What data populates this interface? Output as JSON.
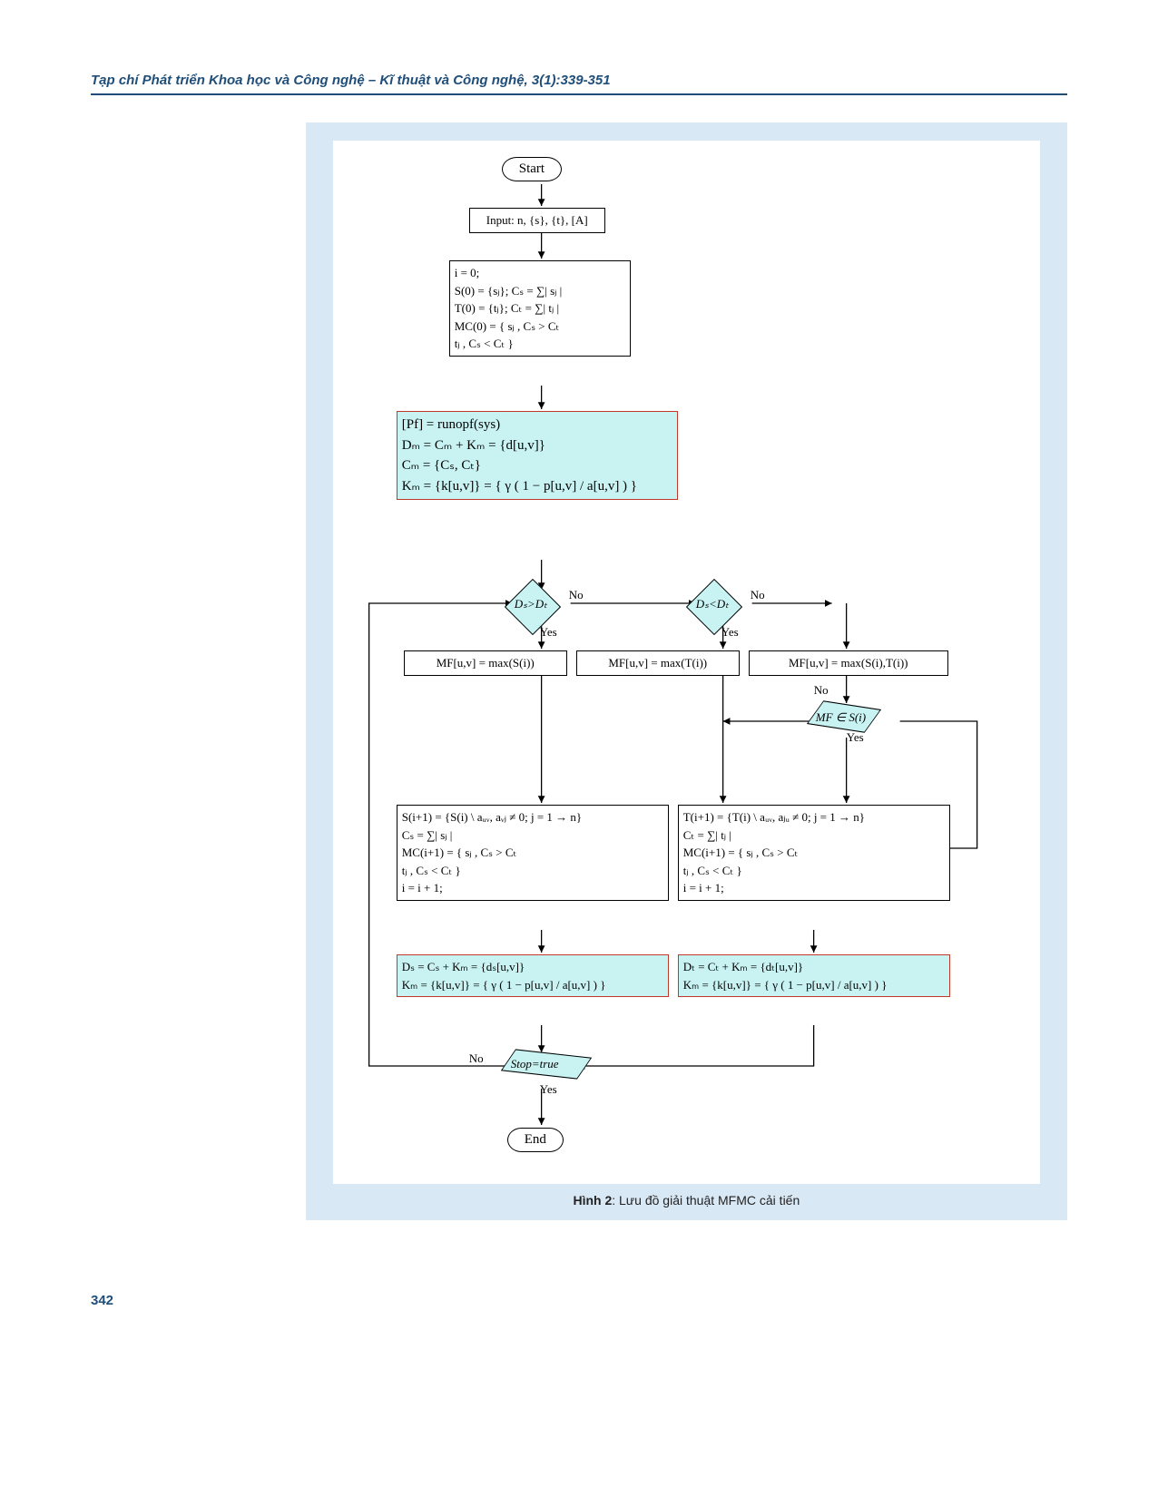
{
  "header": "Tạp chí Phát triển Khoa học và Công nghệ – Kĩ thuật và Công nghệ, 3(1):339-351",
  "pagenum": "342",
  "caption_bold": "Hình 2",
  "caption_rest": ": Lưu đồ giải thuật MFMC cải tiến",
  "flow": {
    "start": "Start",
    "end": "End",
    "input": "Input: n, {s}, {t}, [A]",
    "init": "i = 0;\nS(0) = {sⱼ}; Cₛ = ∑| sⱼ |\nT(0) = {tⱼ}; Cₜ = ∑| tⱼ |\nMC(0) = { sⱼ , Cₛ > Cₜ\n               tⱼ , Cₛ < Cₜ }",
    "runopf": "[Pf] = runopf(sys)\nDₘ = Cₘ + Kₘ = {d[u,v]}\nCₘ = {Cₛ, Cₜ}\nKₘ = {k[u,v]} = { γ ( 1 − p[u,v] / a[u,v] ) }",
    "dec1": "Dₛ>Dₜ",
    "dec2": "Dₛ<Dₜ",
    "mf_s": "MF[u,v] = max(S(i))",
    "mf_t": "MF[u,v] = max(T(i))",
    "mf_st": "MF[u,v] = max(S(i),T(i))",
    "dec_mf": "MF ∈ S(i)",
    "updS": "S(i+1) = {S(i) \\ aᵤᵥ, aᵥⱼ ≠ 0; j = 1 → n}\nCₛ = ∑| sⱼ |\nMC(i+1) = { sⱼ , Cₛ > Cₜ\n                 tⱼ , Cₛ < Cₜ }\ni = i + 1;",
    "updT": "T(i+1) = {T(i) \\ aᵤᵥ, aⱼᵤ ≠ 0; j = 1 → n}\nCₜ = ∑| tⱼ |\nMC(i+1) = { sⱼ , Cₛ > Cₜ\n                 tⱼ , Cₛ < Cₜ }\ni = i + 1;",
    "DsBox": "Dₛ = Cₛ + Kₘ = {dₛ[u,v]}\nKₘ = {k[u,v]} = { γ ( 1 − p[u,v] / a[u,v] ) }",
    "DtBox": "Dₜ = Cₜ + Kₘ = {dₜ[u,v]}\nKₘ = {k[u,v]} = { γ ( 1 − p[u,v] / a[u,v] ) }",
    "stop": "Stop=true",
    "yes": "Yes",
    "no": "No"
  }
}
